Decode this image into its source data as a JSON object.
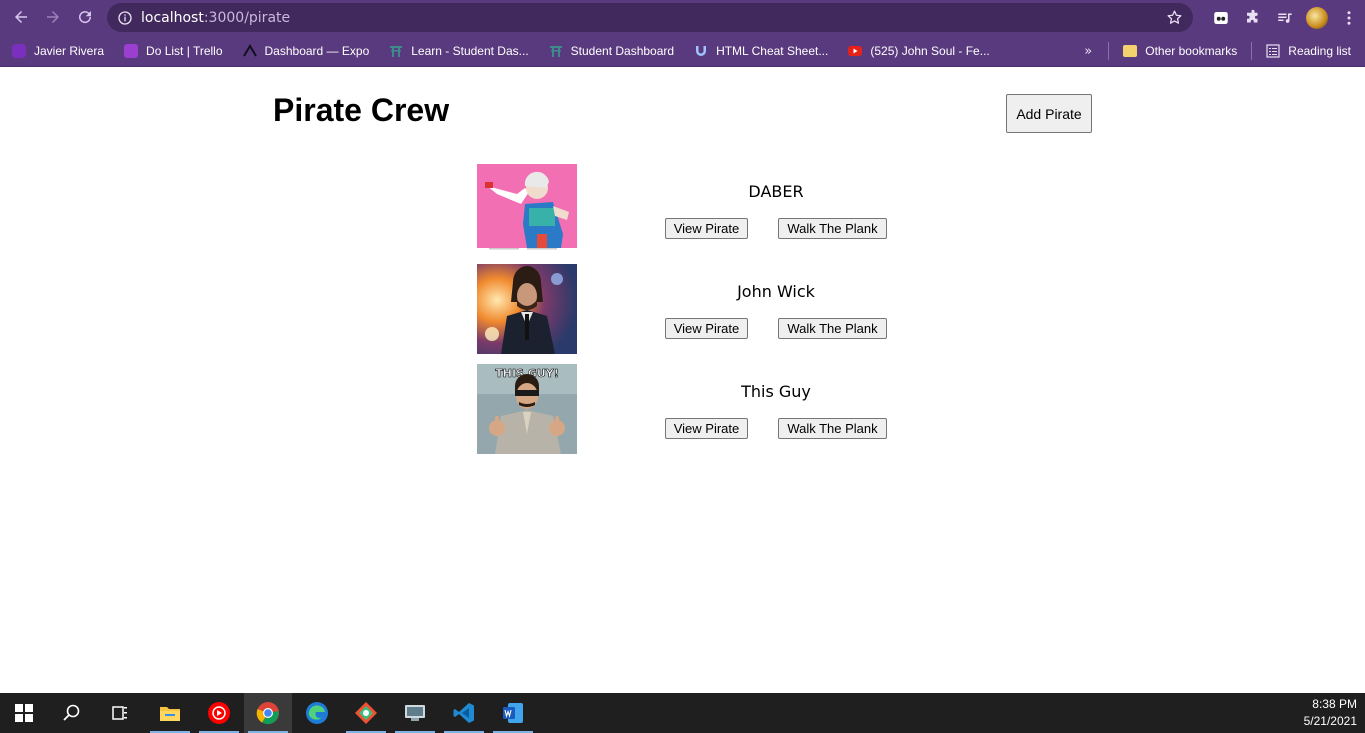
{
  "browser": {
    "url_host": "localhost",
    "url_path": ":3000/pirate",
    "bookmarks": [
      {
        "label": "Javier Rivera",
        "color": "#7b2fbf"
      },
      {
        "label": "Do List | Trello",
        "color": "#9b3fd0"
      },
      {
        "label": "Dashboard — Expo",
        "color": "#1a1a2e"
      },
      {
        "label": "Learn - Student Das...",
        "color": "#2a6f6f"
      },
      {
        "label": "Student Dashboard",
        "color": "#2a6f6f"
      },
      {
        "label": "HTML Cheat Sheet...",
        "color": "#3a4a8a"
      },
      {
        "label": "(525) John Soul - Fe...",
        "color": "#e62117"
      }
    ],
    "other_bookmarks": "Other bookmarks",
    "reading_list": "Reading list"
  },
  "page": {
    "title": "Pirate Crew",
    "add_button": "Add Pirate",
    "pirates": [
      {
        "name": "DABER",
        "view_label": "View Pirate",
        "plank_label": "Walk The Plank",
        "image": "dabbing-grandma-image"
      },
      {
        "name": "John Wick",
        "view_label": "View Pirate",
        "plank_label": "Walk The Plank",
        "image": "john-wick-image"
      },
      {
        "name": "This Guy",
        "view_label": "View Pirate",
        "plank_label": "Walk The Plank",
        "image": "this-guy-meme-image",
        "image_caption": "THIS GUY!"
      }
    ]
  },
  "taskbar": {
    "time": "8:38 PM",
    "date": "5/21/2021"
  }
}
